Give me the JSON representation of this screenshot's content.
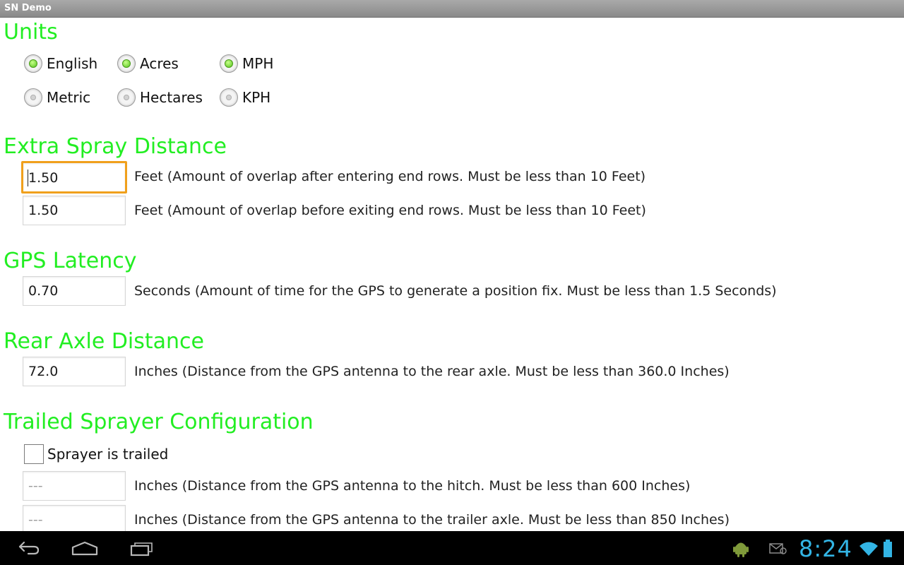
{
  "window": {
    "title": "SN Demo"
  },
  "units": {
    "title": "Units",
    "options": [
      {
        "label": "English",
        "checked": true
      },
      {
        "label": "Acres",
        "checked": true
      },
      {
        "label": "MPH",
        "checked": true
      },
      {
        "label": "Metric",
        "checked": false
      },
      {
        "label": "Hectares",
        "checked": false
      },
      {
        "label": "KPH",
        "checked": false
      }
    ]
  },
  "extra_spray": {
    "title": "Extra Spray Distance",
    "entering_value": "1.50",
    "entering_desc": "Feet (Amount of overlap after entering end rows. Must be less than 10 Feet)",
    "exiting_value": "1.50",
    "exiting_desc": "Feet (Amount of overlap before exiting end rows. Must be less than 10 Feet)"
  },
  "gps_latency": {
    "title": "GPS Latency",
    "value": "0.70",
    "desc": "Seconds (Amount of time for the GPS to generate a position fix. Must be less than 1.5 Seconds)"
  },
  "rear_axle": {
    "title": "Rear Axle Distance",
    "value": "72.0",
    "desc": "Inches (Distance from the GPS antenna to the rear axle. Must be less than 360.0 Inches)"
  },
  "trailed": {
    "title": "Trailed Sprayer Configuration",
    "checkbox_label": "Sprayer is trailed",
    "checkbox_checked": false,
    "hitch_placeholder": "---",
    "hitch_desc": "Inches (Distance from the GPS antenna to the hitch. Must be less than 600 Inches)",
    "trailer_placeholder": "---",
    "trailer_desc": "Inches (Distance from the GPS antenna to the trailer axle. Must be less than 850 Inches)"
  },
  "status_bar": {
    "time": "8:24",
    "icons": [
      "android-debug-icon",
      "notification-icon",
      "wifi-icon",
      "battery-icon"
    ]
  },
  "nav": {
    "icons": [
      "back-icon",
      "home-icon",
      "recent-apps-icon"
    ]
  },
  "colors": {
    "section_title": "#22ee22",
    "focus": "#f0a01c",
    "clock": "#33b5e5"
  }
}
